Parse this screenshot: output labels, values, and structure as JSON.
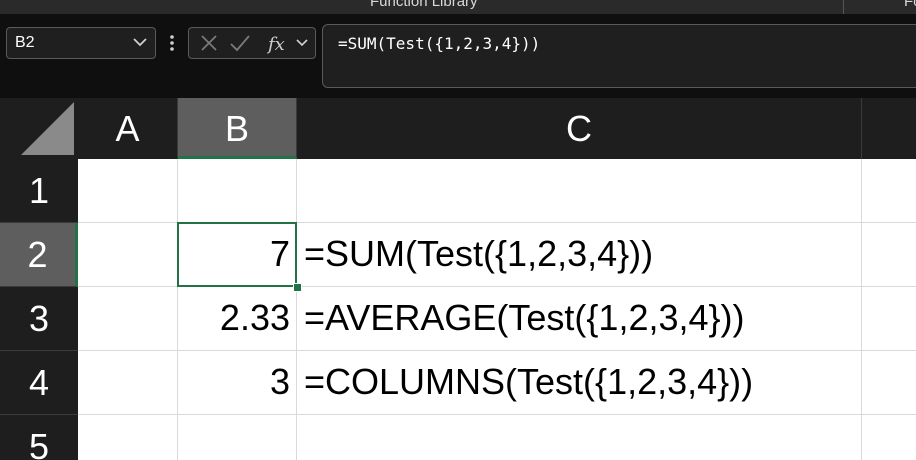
{
  "ribbon": {
    "group_label": "Function Library",
    "group_label_2": "Fo"
  },
  "formula_bar": {
    "name_box": "B2",
    "formula": "=SUM(Test({1,2,3,4}))",
    "icons": [
      "cancel-icon",
      "enter-icon",
      "insert-function-icon"
    ]
  },
  "columns": [
    "A",
    "B",
    "C"
  ],
  "rows": [
    "1",
    "2",
    "3",
    "4",
    "5"
  ],
  "cells": {
    "B2": "7",
    "C2": "=SUM(Test({1,2,3,4}))",
    "B3": "2.33",
    "C3": "=AVERAGE(Test({1,2,3,4}))",
    "B4": "3",
    "C4": "=COLUMNS(Test({1,2,3,4}))"
  },
  "colors": {
    "accent": "#217346",
    "header_bg": "#1e1e1e",
    "selected_header_bg": "#5e5e5e"
  }
}
